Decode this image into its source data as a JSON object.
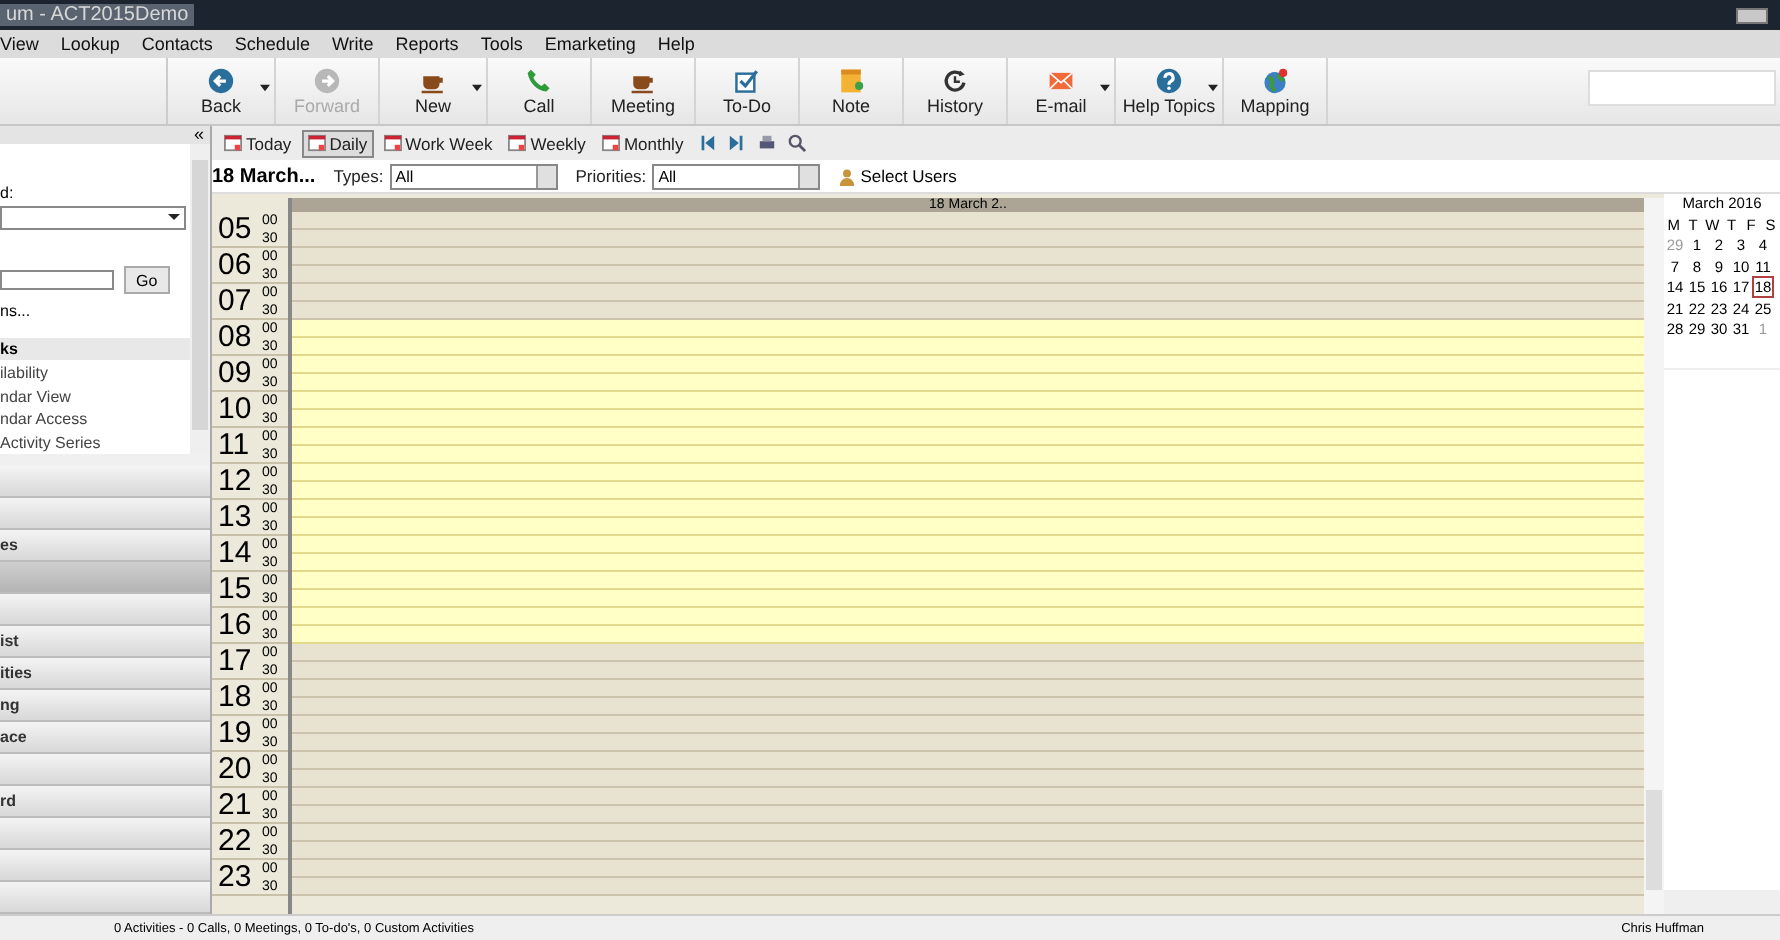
{
  "window": {
    "title": "um - ACT2015Demo"
  },
  "menu": [
    "View",
    "Lookup",
    "Contacts",
    "Schedule",
    "Write",
    "Reports",
    "Tools",
    "Emarketing",
    "Help"
  ],
  "toolbar": [
    {
      "label": "Back",
      "disabled": false,
      "dropdown": true
    },
    {
      "label": "Forward",
      "disabled": true,
      "dropdown": false
    },
    {
      "label": "New",
      "disabled": false,
      "dropdown": true
    },
    {
      "label": "Call",
      "disabled": false,
      "dropdown": false
    },
    {
      "label": "Meeting",
      "disabled": false,
      "dropdown": false
    },
    {
      "label": "To-Do",
      "disabled": false,
      "dropdown": false
    },
    {
      "label": "Note",
      "disabled": false,
      "dropdown": false
    },
    {
      "label": "History",
      "disabled": false,
      "dropdown": false
    },
    {
      "label": "E-mail",
      "disabled": false,
      "dropdown": true
    },
    {
      "label": "Help Topics",
      "disabled": false,
      "dropdown": true
    },
    {
      "label": "Mapping",
      "disabled": false,
      "dropdown": false
    }
  ],
  "sidebar": {
    "collapse": "«",
    "field_label": "d:",
    "go_button": "Go",
    "link": "ns...",
    "section_title": "ks",
    "tasks": [
      "ilability",
      "ndar View",
      "ndar Access",
      "Activity Series"
    ],
    "groups": [
      {
        "selected": false
      },
      {
        "selected": false
      },
      {
        "label": "es",
        "selected": false
      },
      {
        "selected": true
      },
      {
        "selected": false
      },
      {
        "label": "ist",
        "selected": false
      },
      {
        "label": "ities",
        "selected": false
      },
      {
        "label": "ng",
        "selected": false
      },
      {
        "label": "ace",
        "selected": false
      },
      {
        "selected": false
      },
      {
        "label": "rd",
        "selected": false
      },
      {
        "selected": false
      },
      {
        "selected": false
      },
      {
        "selected": false
      }
    ]
  },
  "views": [
    {
      "label": "Today",
      "selected": false
    },
    {
      "label": "Daily",
      "selected": true
    },
    {
      "label": "Work Week",
      "selected": false
    },
    {
      "label": "Weekly",
      "selected": false
    },
    {
      "label": "Monthly",
      "selected": false
    }
  ],
  "filters": {
    "date": "18 March...",
    "types_label": "Types:",
    "types_value": "All",
    "priorities_label": "Priorities:",
    "priorities_value": "All",
    "select_users": "Select Users"
  },
  "day": {
    "header": "18 March 2..",
    "hours": [
      {
        "hour": "05",
        "minutes": [
          "00",
          "30"
        ],
        "work": false
      },
      {
        "hour": "06",
        "minutes": [
          "00",
          "30"
        ],
        "work": false
      },
      {
        "hour": "07",
        "minutes": [
          "00",
          "30"
        ],
        "work": false
      },
      {
        "hour": "08",
        "minutes": [
          "00",
          "30"
        ],
        "work": true
      },
      {
        "hour": "09",
        "minutes": [
          "00",
          "30"
        ],
        "work": true
      },
      {
        "hour": "10",
        "minutes": [
          "00",
          "30"
        ],
        "work": true
      },
      {
        "hour": "11",
        "minutes": [
          "00",
          "30"
        ],
        "work": true
      },
      {
        "hour": "12",
        "minutes": [
          "00",
          "30"
        ],
        "work": true
      },
      {
        "hour": "13",
        "minutes": [
          "00",
          "30"
        ],
        "work": true
      },
      {
        "hour": "14",
        "minutes": [
          "00",
          "30"
        ],
        "work": true
      },
      {
        "hour": "15",
        "minutes": [
          "00",
          "30"
        ],
        "work": true
      },
      {
        "hour": "16",
        "minutes": [
          "00",
          "30"
        ],
        "work": true
      },
      {
        "hour": "17",
        "minutes": [
          "00",
          "30"
        ],
        "work": false
      },
      {
        "hour": "18",
        "minutes": [
          "00",
          "30"
        ],
        "work": false
      },
      {
        "hour": "19",
        "minutes": [
          "00",
          "30"
        ],
        "work": false
      },
      {
        "hour": "20",
        "minutes": [
          "00",
          "30"
        ],
        "work": false
      },
      {
        "hour": "21",
        "minutes": [
          "00",
          "30"
        ],
        "work": false
      },
      {
        "hour": "22",
        "minutes": [
          "00",
          "30"
        ],
        "work": false
      },
      {
        "hour": "23",
        "minutes": [
          "00",
          "30"
        ],
        "work": false
      }
    ]
  },
  "mini_calendar": {
    "title": "March 2016",
    "weekdays": [
      "M",
      "T",
      "W",
      "T",
      "F",
      "S"
    ],
    "weeks": [
      [
        {
          "day": "29",
          "other_month": true,
          "selected": false
        },
        {
          "day": "1",
          "other_month": false,
          "selected": false
        },
        {
          "day": "2",
          "other_month": false,
          "selected": false
        },
        {
          "day": "3",
          "other_month": false,
          "selected": false
        },
        {
          "day": "4",
          "other_month": false,
          "selected": false
        }
      ],
      [
        {
          "day": "7",
          "other_month": false,
          "selected": false
        },
        {
          "day": "8",
          "other_month": false,
          "selected": false
        },
        {
          "day": "9",
          "other_month": false,
          "selected": false
        },
        {
          "day": "10",
          "other_month": false,
          "selected": false
        },
        {
          "day": "11",
          "other_month": false,
          "selected": false
        }
      ],
      [
        {
          "day": "14",
          "other_month": false,
          "selected": false
        },
        {
          "day": "15",
          "other_month": false,
          "selected": false
        },
        {
          "day": "16",
          "other_month": false,
          "selected": false
        },
        {
          "day": "17",
          "other_month": false,
          "selected": false
        },
        {
          "day": "18",
          "other_month": false,
          "selected": true
        }
      ],
      [
        {
          "day": "21",
          "other_month": false,
          "selected": false
        },
        {
          "day": "22",
          "other_month": false,
          "selected": false
        },
        {
          "day": "23",
          "other_month": false,
          "selected": false
        },
        {
          "day": "24",
          "other_month": false,
          "selected": false
        },
        {
          "day": "25",
          "other_month": false,
          "selected": false
        }
      ],
      [
        {
          "day": "28",
          "other_month": false,
          "selected": false
        },
        {
          "day": "29",
          "other_month": false,
          "selected": false
        },
        {
          "day": "30",
          "other_month": false,
          "selected": false
        },
        {
          "day": "31",
          "other_month": false,
          "selected": false
        },
        {
          "day": "1",
          "other_month": true,
          "selected": false
        }
      ]
    ]
  },
  "status_bar": {
    "summary": "0 Activities - 0 Calls, 0 Meetings, 0 To-do's, 0 Custom Activities",
    "user": "Chris Huffman"
  }
}
